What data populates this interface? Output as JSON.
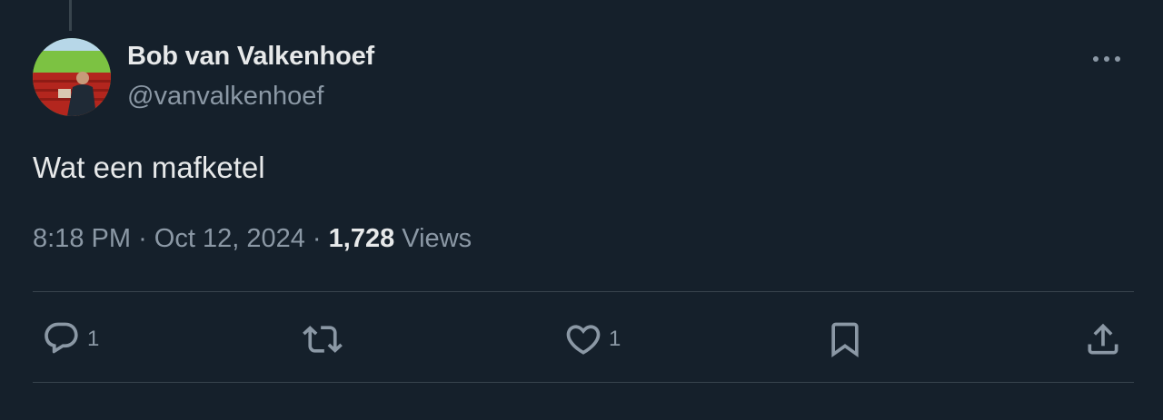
{
  "tweet": {
    "author_name": "Bob van Valkenhoef",
    "author_handle": "@vanvalkenhoef",
    "text": "Wat een mafketel",
    "time": "8:18 PM",
    "separator": "·",
    "date": "Oct 12, 2024",
    "views_count": "1,728",
    "views_label": "Views"
  },
  "actions": {
    "reply": {
      "icon": "reply-icon",
      "count": "1"
    },
    "retweet": {
      "icon": "retweet-icon",
      "count": ""
    },
    "like": {
      "icon": "heart-icon",
      "count": "1"
    },
    "bookmark": {
      "icon": "bookmark-icon",
      "count": ""
    },
    "share": {
      "icon": "share-icon",
      "count": ""
    }
  },
  "more_icon": "more-dots-icon",
  "colors": {
    "background": "#15202b",
    "primary_text": "#e7e9ea",
    "secondary_text": "#8b98a5",
    "divider": "#38444d"
  }
}
